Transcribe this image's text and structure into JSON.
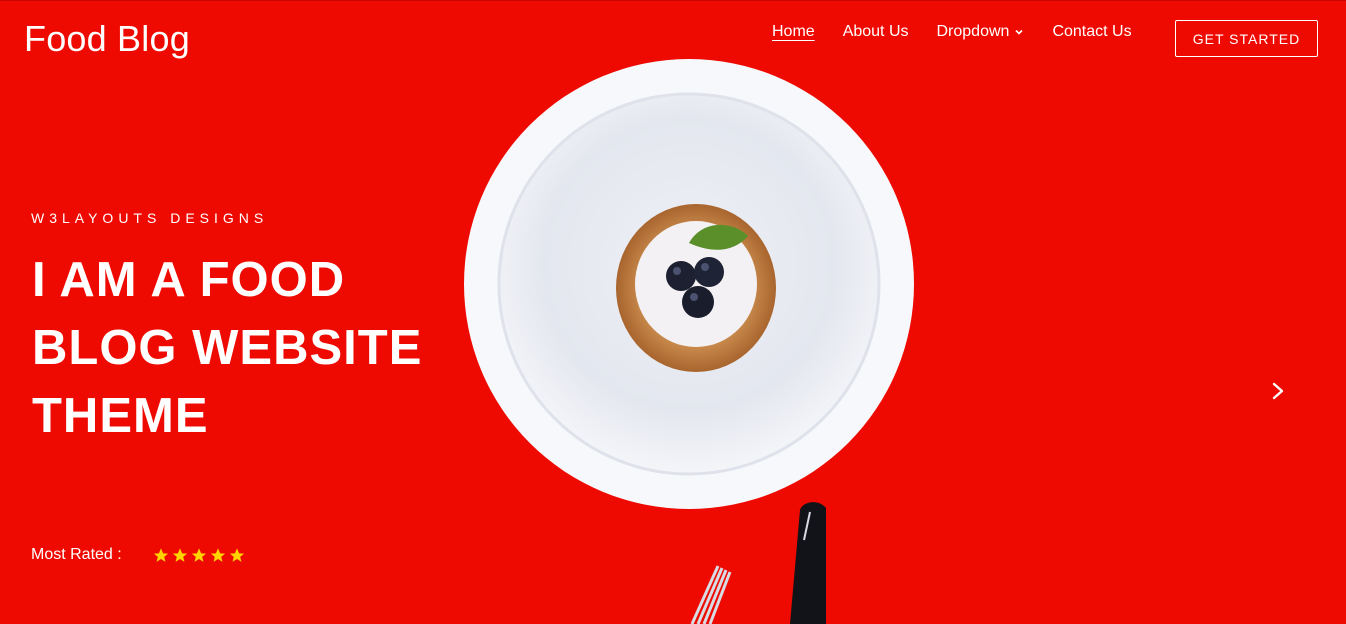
{
  "brand": {
    "title": "Food Blog"
  },
  "nav": {
    "items": [
      {
        "label": "Home",
        "active": true
      },
      {
        "label": "About Us"
      },
      {
        "label": "Dropdown"
      },
      {
        "label": "Contact Us"
      }
    ],
    "cta_label": "GET STARTED"
  },
  "hero": {
    "eyebrow": "W3LAYOUTS DESIGNS",
    "headline_lines": [
      "I AM A FOOD",
      "BLOG WEBSITE",
      "THEME"
    ],
    "rating_label": "Most Rated :",
    "rating_stars": 5,
    "rating_max": 5
  },
  "colors": {
    "background": "#ee0a00",
    "star": "#ffd400",
    "text": "#ffffff"
  },
  "icons": {
    "dropdown": "chevron-down-icon",
    "slider_next": "chevron-right-icon",
    "rating": "star-icon"
  }
}
